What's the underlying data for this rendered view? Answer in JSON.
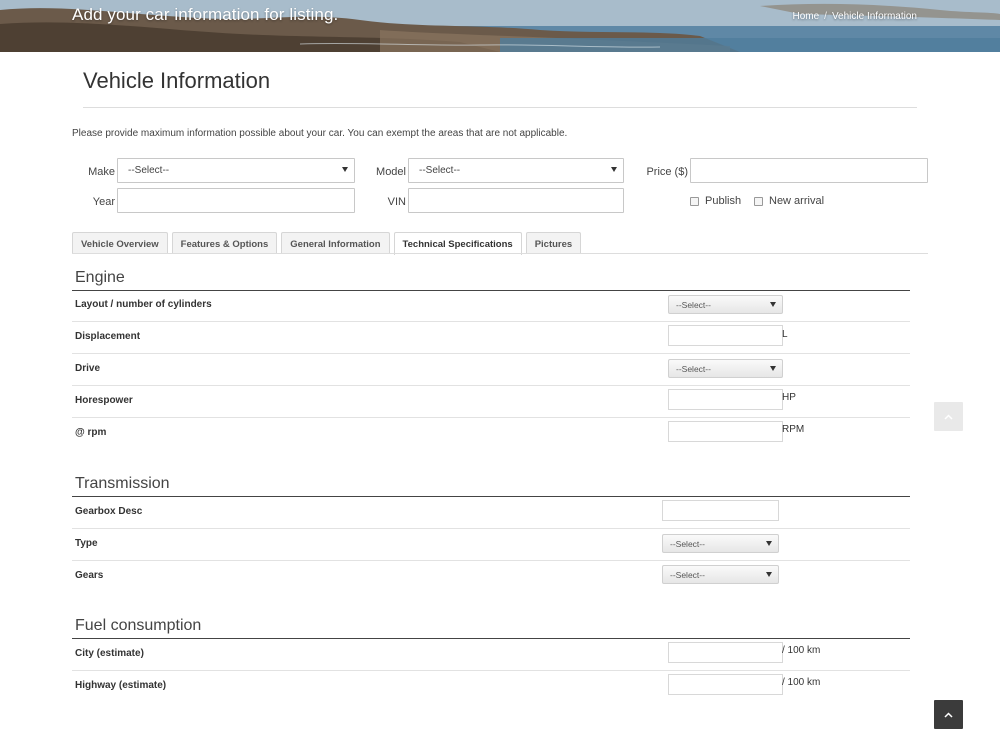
{
  "banner": {
    "title": "Add your car information for listing.",
    "breadcrumb": {
      "home": "Home",
      "separator": "/",
      "current": "Vehicle Information"
    }
  },
  "page": {
    "title": "Vehicle Information",
    "intro": "Please provide maximum information possible about your car. You can exempt the areas that are not applicable."
  },
  "form": {
    "make": {
      "label": "Make",
      "value": "--Select--"
    },
    "model": {
      "label": "Model",
      "value": "--Select--"
    },
    "price": {
      "label": "Price ($)",
      "value": ""
    },
    "year": {
      "label": "Year",
      "value": ""
    },
    "vin": {
      "label": "VIN",
      "value": ""
    },
    "publish": {
      "label": "Publish",
      "checked": false
    },
    "new_arrival": {
      "label": "New arrival",
      "checked": false
    }
  },
  "tabs": [
    {
      "label": "Vehicle Overview",
      "active": false
    },
    {
      "label": "Features & Options",
      "active": false
    },
    {
      "label": "General Information",
      "active": false
    },
    {
      "label": "Technical Specifications",
      "active": true
    },
    {
      "label": "Pictures",
      "active": false
    }
  ],
  "engine": {
    "title": "Engine",
    "layout": {
      "label": "Layout / number of cylinders",
      "value": "--Select--"
    },
    "displacement": {
      "label": "Displacement",
      "unit": "L"
    },
    "drive": {
      "label": "Drive",
      "value": "--Select--"
    },
    "horsepower": {
      "label": "Horespower",
      "unit": "HP"
    },
    "rpm": {
      "label": "@ rpm",
      "unit": "RPM"
    }
  },
  "transmission": {
    "title": "Transmission",
    "gearbox": {
      "label": "Gearbox Desc"
    },
    "type": {
      "label": "Type",
      "value": "--Select--"
    },
    "gears": {
      "label": "Gears",
      "value": "--Select--"
    }
  },
  "fuel": {
    "title": "Fuel consumption",
    "city": {
      "label": "City (estimate)",
      "unit": "/ 100 km"
    },
    "highway": {
      "label": "Highway (estimate)",
      "unit": "/ 100 km"
    }
  },
  "icons": {
    "scroll_up": "chevron-up-icon",
    "dropdown": "caret-down-icon"
  },
  "colors": {
    "dark_button": "#3b3b3b",
    "light_button": "#e9e9e9",
    "section_rule": "#444444"
  }
}
